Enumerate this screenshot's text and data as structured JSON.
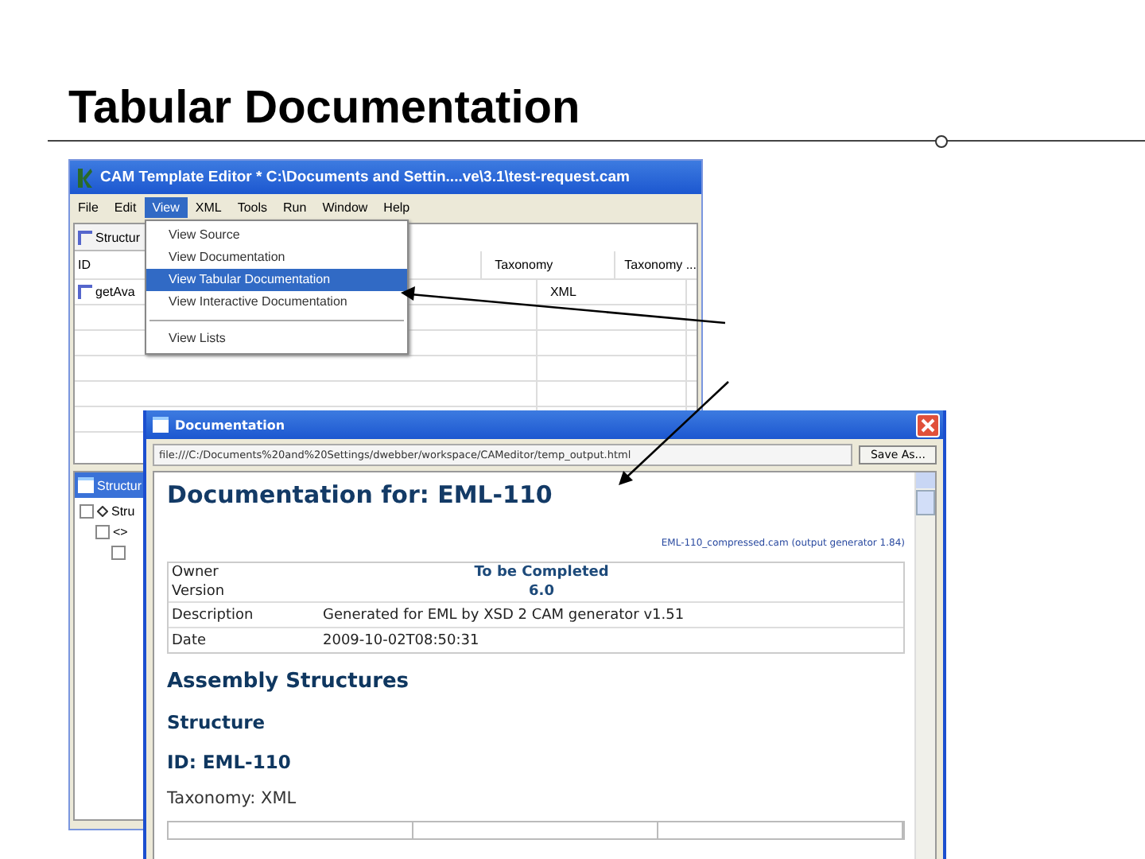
{
  "slide": {
    "title": "Tabular Documentation"
  },
  "editor": {
    "title": "CAM Template Editor * C:\\Documents and Settin....ve\\3.1\\test-request.cam",
    "menu": [
      {
        "label": "File",
        "selected": false
      },
      {
        "label": "Edit",
        "selected": false
      },
      {
        "label": "View",
        "selected": true
      },
      {
        "label": "XML",
        "selected": false
      },
      {
        "label": "Tools",
        "selected": false
      },
      {
        "label": "Run",
        "selected": false
      },
      {
        "label": "Window",
        "selected": false
      },
      {
        "label": "Help",
        "selected": false
      }
    ],
    "dropdown": [
      {
        "label": "View Source",
        "selected": false,
        "separator_before": false
      },
      {
        "label": "View Documentation",
        "selected": false,
        "separator_before": false
      },
      {
        "label": "View Tabular Documentation",
        "selected": true,
        "separator_before": false
      },
      {
        "label": "View Interactive Documentation",
        "selected": false,
        "separator_before": false
      },
      {
        "label": "View Lists",
        "selected": false,
        "separator_before": true
      }
    ],
    "panel_title": "Structur",
    "columns": [
      "ID",
      "Taxonomy",
      "Taxonomy ..."
    ],
    "row": [
      "getAva",
      "XML"
    ],
    "lower_panel_title": "Structur",
    "tree": [
      {
        "label": "Stru",
        "children": [
          {
            "label": "<>"
          }
        ]
      }
    ]
  },
  "documentation": {
    "title": "Documentation",
    "address": "file:///C:/Documents%20and%20Settings/dwebber/workspace/CAMeditor/temp_output.html",
    "save_button": "Save As...",
    "heading": "Documentation for: EML-110",
    "source_note": "EML-110_compressed.cam (output generator 1.84)",
    "properties": [
      {
        "name": "Owner",
        "value": "To be Completed",
        "kind": "centered"
      },
      {
        "name": "Version",
        "value": "6.0",
        "kind": "centered"
      },
      {
        "name": "Description",
        "value": "Generated for EML by XSD 2 CAM generator v1.51",
        "kind": "plain"
      },
      {
        "name": "Date",
        "value": "2009-10-02T08:50:31",
        "kind": "plain"
      }
    ],
    "section": "Assembly Structures",
    "subsection": "Structure",
    "id_heading": "ID: EML-110",
    "taxonomy": "Taxonomy: XML"
  }
}
